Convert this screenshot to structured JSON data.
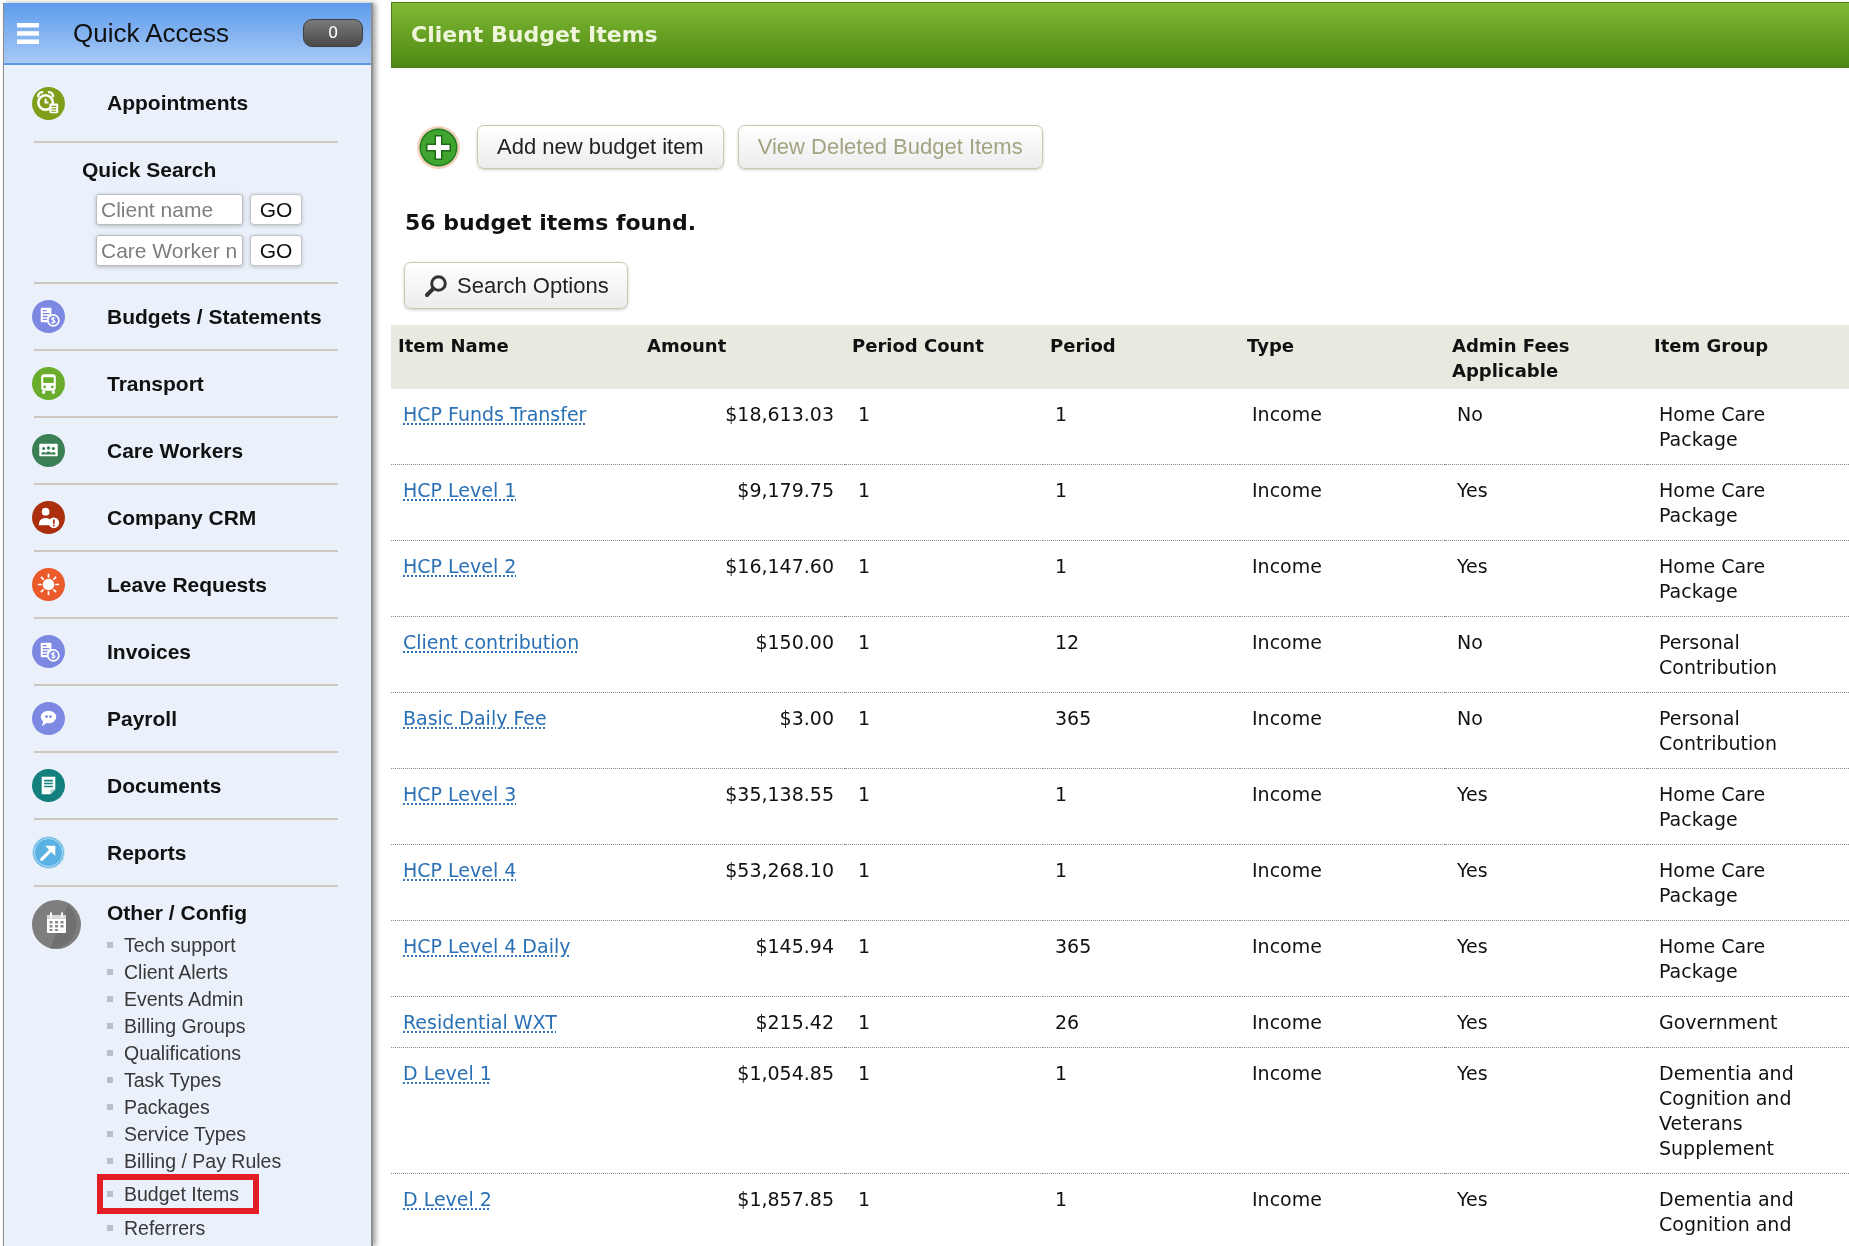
{
  "sidebar": {
    "title": "Quick Access",
    "badge": "0",
    "sections": [
      {
        "kind": "link",
        "label": "Appointments"
      },
      {
        "kind": "search",
        "title": "Quick Search",
        "fields": [
          {
            "placeholder": "Client name",
            "button": "GO"
          },
          {
            "placeholder": "Care Worker n",
            "button": "GO"
          }
        ]
      },
      {
        "kind": "link",
        "label": "Budgets / Statements"
      },
      {
        "kind": "link",
        "label": "Transport"
      },
      {
        "kind": "link",
        "label": "Care Workers"
      },
      {
        "kind": "link",
        "label": "Company CRM"
      },
      {
        "kind": "link",
        "label": "Leave Requests"
      },
      {
        "kind": "link",
        "label": "Invoices"
      },
      {
        "kind": "link",
        "label": "Payroll"
      },
      {
        "kind": "link",
        "label": "Documents"
      },
      {
        "kind": "link",
        "label": "Reports"
      },
      {
        "kind": "group",
        "label": "Other / Config",
        "children": [
          {
            "label": "Tech support",
            "highlighted": false
          },
          {
            "label": "Client Alerts",
            "highlighted": false
          },
          {
            "label": "Events Admin",
            "highlighted": false
          },
          {
            "label": "Billing Groups",
            "highlighted": false
          },
          {
            "label": "Qualifications",
            "highlighted": false
          },
          {
            "label": "Task Types",
            "highlighted": false
          },
          {
            "label": "Packages",
            "highlighted": false
          },
          {
            "label": "Service Types",
            "highlighted": false
          },
          {
            "label": "Billing / Pay Rules",
            "highlighted": false
          },
          {
            "label": "Budget Items",
            "highlighted": true
          },
          {
            "label": "Referrers",
            "highlighted": false
          }
        ]
      }
    ]
  },
  "page": {
    "title": "Client Budget Items",
    "buttons": [
      {
        "label": "Add new budget item",
        "disabled": false
      },
      {
        "label": "View Deleted Budget Items",
        "disabled": true
      }
    ],
    "result_count": "56 budget items found.",
    "search_options": "Search Options",
    "table": {
      "columns": [
        "Item Name",
        "Amount",
        "Period Count",
        "Period",
        "Type",
        "Admin Fees Applicable",
        "Item Group"
      ],
      "rows": [
        [
          "HCP Funds Transfer",
          "$18,613.03",
          "1",
          "1",
          "Income",
          "No",
          "Home Care Package"
        ],
        [
          "HCP Level 1",
          "$9,179.75",
          "1",
          "1",
          "Income",
          "Yes",
          "Home Care Package"
        ],
        [
          "HCP Level 2",
          "$16,147.60",
          "1",
          "1",
          "Income",
          "Yes",
          "Home Care Package"
        ],
        [
          "Client contribution",
          "$150.00",
          "1",
          "12",
          "Income",
          "No",
          "Personal Contribution"
        ],
        [
          "Basic Daily Fee",
          "$3.00",
          "1",
          "365",
          "Income",
          "No",
          "Personal Contribution"
        ],
        [
          "HCP Level 3",
          "$35,138.55",
          "1",
          "1",
          "Income",
          "Yes",
          "Home Care Package"
        ],
        [
          "HCP Level 4",
          "$53,268.10",
          "1",
          "1",
          "Income",
          "Yes",
          "Home Care Package"
        ],
        [
          "HCP Level 4 Daily",
          "$145.94",
          "1",
          "365",
          "Income",
          "Yes",
          "Home Care Package"
        ],
        [
          "Residential WXT",
          "$215.42",
          "1",
          "26",
          "Income",
          "Yes",
          "Government"
        ],
        [
          "D Level 1",
          "$1,054.85",
          "1",
          "1",
          "Income",
          "Yes",
          "Dementia and Cognition and Veterans Supplement"
        ],
        [
          "D Level 2",
          "$1,857.85",
          "1",
          "1",
          "Income",
          "Yes",
          "Dementia and Cognition and"
        ]
      ]
    }
  }
}
